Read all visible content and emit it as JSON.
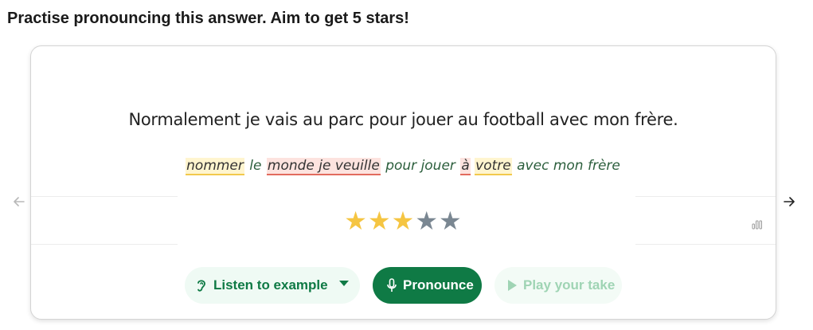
{
  "prompt": "Practise pronouncing this answer. Aim to get 5 stars!",
  "sentence": "Normalement je vais au parc pour jouer au football avec mon frère.",
  "transcript": [
    {
      "text": "nommer",
      "status": "meh"
    },
    {
      "text": "le",
      "status": "ok"
    },
    {
      "text": "monde je veuille",
      "status": "bad"
    },
    {
      "text": "pour jouer",
      "status": "ok"
    },
    {
      "text": "à",
      "status": "bad"
    },
    {
      "text": "votre",
      "status": "meh"
    },
    {
      "text": "avec mon frère",
      "status": "ok"
    }
  ],
  "rating": {
    "stars_filled": 3,
    "stars_total": 5
  },
  "buttons": {
    "listen": "Listen to example",
    "pronounce": "Pronounce",
    "play": "Play your take"
  },
  "icons": {
    "listen": "ear-icon",
    "listen_menu": "caret-down-icon",
    "pronounce": "microphone-icon",
    "play": "play-icon",
    "prev": "arrow-left-icon",
    "next": "arrow-right-icon",
    "stats": "bar-chart-icon"
  },
  "colors": {
    "accent": "#0f7a45",
    "star_on": "#f5c542",
    "star_off": "#7a8792",
    "word_meh": "#f2c94c",
    "word_bad": "#e26b5e"
  }
}
